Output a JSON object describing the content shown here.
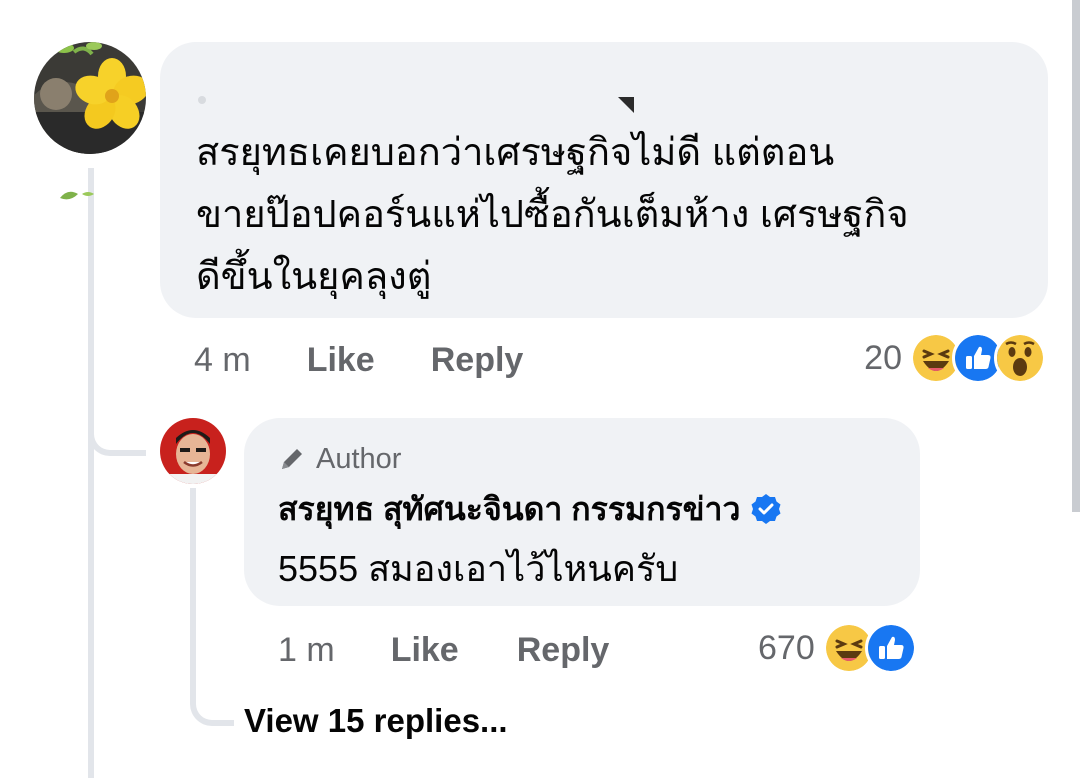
{
  "comment": {
    "text_line1": "สรยุทธเคยบอกว่าเศรษฐกิจไม่ดี แต่ตอน",
    "text_line2": "ขายป๊อปคอร์นแห่ไปซื้อกันเต็มห้าง เศรษฐกิจ",
    "text_line3": "ดีขึ้นในยุคลุงตู่",
    "time": "4 m",
    "like_label": "Like",
    "reply_label": "Reply",
    "reaction_count": "20",
    "reactions": [
      "haha-icon",
      "like-icon",
      "wow-icon"
    ]
  },
  "reply": {
    "author_badge": "Author",
    "author_name": "สรยุทธ สุทัศนะจินดา กรรมกรข่าว",
    "verified_icon": "verified-check-icon",
    "text": "5555 สมองเอาไว้ไหนครับ",
    "time": "1 m",
    "like_label": "Like",
    "reply_label": "Reply",
    "reaction_count": "670",
    "reactions": [
      "haha-icon",
      "like-icon"
    ]
  },
  "view_replies": "View 15 replies...",
  "colors": {
    "bubble": "#f0f2f5",
    "secondary_text": "#65676b",
    "like_blue": "#1877f2",
    "reaction_yellow": "#f7c845"
  }
}
